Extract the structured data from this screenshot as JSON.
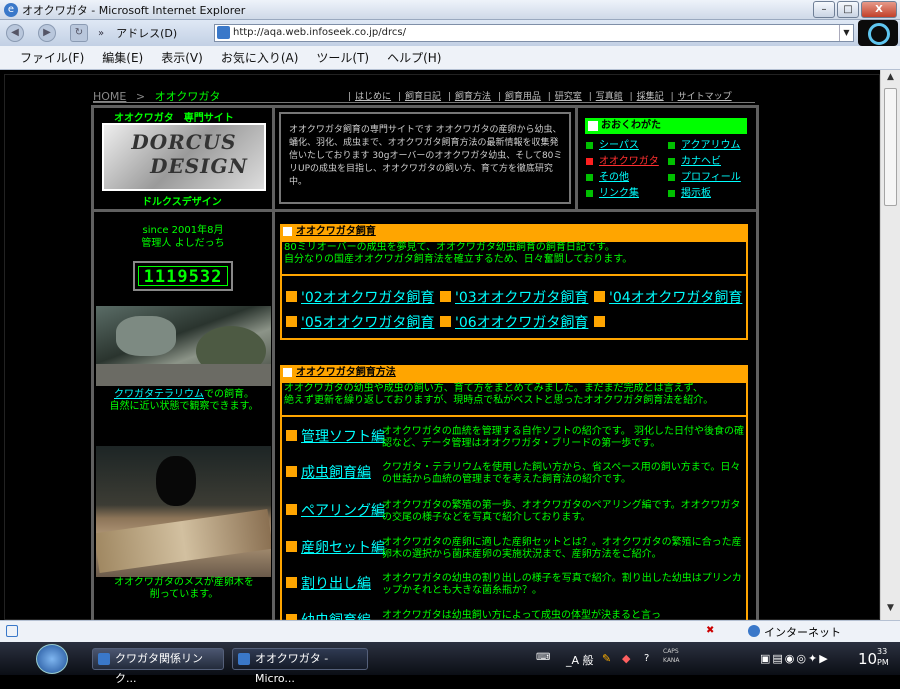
{
  "window": {
    "title": "オオクワガタ - Microsoft Internet Explorer",
    "min_label": "–",
    "max_label": "□",
    "close_label": "X"
  },
  "toolbar": {
    "address_label": "アドレス(D)",
    "url": "http://aqa.web.infoseek.co.jp/drcs/"
  },
  "menu": [
    "ファイル(F)",
    "編集(E)",
    "表示(V)",
    "お気に入り(A)",
    "ツール(T)",
    "ヘルプ(H)"
  ],
  "page": {
    "breadcrumb_home": "HOME",
    "breadcrumb_sep": ">",
    "breadcrumb_current": "オオクワガタ",
    "top_links": [
      "はじめに",
      "飼育日記",
      "飼育方法",
      "飼育用品",
      "研究室",
      "写真館",
      "採集記",
      "サイトマップ"
    ],
    "logo_title": "オオクワガタ　専門サイト",
    "logo_line1": "DORCUS",
    "logo_line2": "DESIGN",
    "logo_caption": "ドルクスデザイン",
    "intro": "オオクワガタ飼育の専門サイトです オオクワガタの産卵から幼虫、蛹化、羽化、成虫まで、オオクワガタ飼育方法の最新情報を収集発信いたしております 30gオーバーのオオクワガタ幼虫、そして80ミリUPの成虫を目指し、オオクワガタの飼い方、育て方を徹底研究中。",
    "genre_title": "おおくわがた",
    "genre_links": [
      "シーパス",
      "アクアリウム",
      "オオクワガタ",
      "カナヘビ",
      "その他",
      "プロフィール",
      "リンク集",
      "掲示板"
    ],
    "since": "since 2001年8月",
    "admin": "管理人 よしだっち",
    "counter": "1119532",
    "photo1_link": "クワガタテラリウム",
    "photo1_caption_a": "での飼育。",
    "photo1_caption_b": "自然に近い状態で観察できます。",
    "photo2_caption_a": "オオクワガタのメスが産卵木を",
    "photo2_caption_b": "削っています。",
    "diary": {
      "title": "オオクワガタ飼育",
      "desc1": "80ミリオーバーの成虫を夢見て、オオクワガタ幼虫飼育の飼育日記です。",
      "desc2": "自分なりの国産オオクワガタ飼育法を確立するため、日々奮闘しております。",
      "years": [
        "'02オオクワガタ飼育",
        "'03オオクワガタ飼育",
        "'04オオクワガタ飼育",
        "'05オオクワガタ飼育",
        "'06オオクワガタ飼育"
      ]
    },
    "method": {
      "title": "オオクワガタ飼育方法",
      "desc1": "オオクワガタの幼虫や成虫の飼い方、育て方をまとめてみました。まだまだ完成とは言えず、",
      "desc2": "絶えず更新を繰り返しておりますが、現時点で私がベストと思ったオオクワガタ飼育法を紹介。",
      "items": [
        {
          "label": "管理ソフト編",
          "desc": "オオクワガタの血統を管理する自作ソフトの紹介です。 羽化した日付や後食の確認など、データ管理はオオクワガタ・ブリードの第一歩です。"
        },
        {
          "label": "成虫飼育編",
          "desc": "クワガタ・テラリウムを使用した飼い方から、省スペース用の飼い方まで。日々の世話から血統の管理までを考えた飼育法の紹介です。"
        },
        {
          "label": "ペアリング編",
          "desc": "オオクワガタの繁殖の第一歩、オオクワガタのペアリング編です。オオクワガタの交尾の様子などを写真で紹介しております。"
        },
        {
          "label": "産卵セット編",
          "desc": "オオクワガタの産卵に適した産卵セットとは？。オオクワガタの繁殖に合った産卵木の選択から菌床産卵の実施状況まで、産卵方法をご紹介。"
        },
        {
          "label": "割り出し編",
          "desc": "オオクワガタの幼虫の割り出しの様子を写真で紹介。割り出した幼虫はプリンカップかそれとも大きな菌糸瓶か？。"
        },
        {
          "label": "幼虫飼育編",
          "desc": "オオクワガタは幼虫飼い方によって成虫の体型が決まると言っ"
        }
      ]
    }
  },
  "status": {
    "zone": "インターネット"
  },
  "taskbar": {
    "tasks": [
      "クワガタ関係リンク...",
      "オオクワガタ - Micro..."
    ],
    "ime": "_A 般",
    "caps": "CAPS",
    "kana": "KANA",
    "time": "10",
    "time_min": "33",
    "ampm": "PM"
  },
  "colors": {
    "accent_green": "#00ff00",
    "link_cyan": "#00ffff",
    "section_orange": "#ffa500"
  }
}
